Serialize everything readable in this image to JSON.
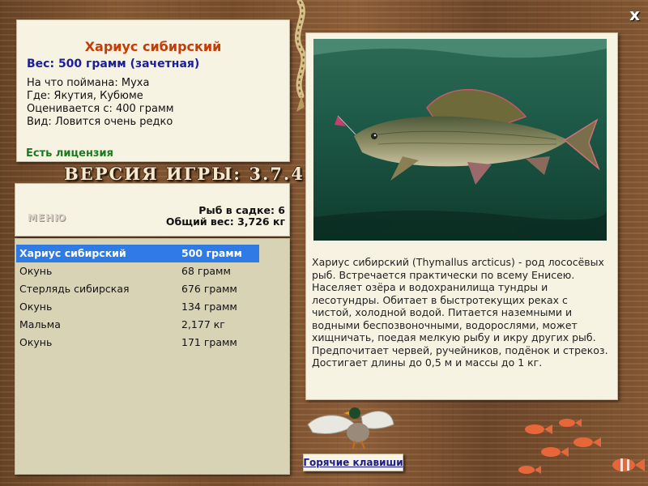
{
  "close_label": "x",
  "fish": {
    "name": "Хариус сибирский",
    "weight": "Вес: 500 грамм (зачетная)",
    "bait": "На что поймана: Муха",
    "location": "Где: Якутия, Кубюме",
    "valued_from": "Оценивается с: 400 грамм",
    "rarity": "Вид: Ловится очень редко",
    "license": "Есть лицензия"
  },
  "version": "ВЕРСИЯ ИГРЫ: 3.7.4",
  "menu_label": "МЕНЮ",
  "stats": {
    "fish_count": "Рыб в садке: 6",
    "total_weight": "Общий вес: 3,726 кг"
  },
  "catch_list": [
    {
      "name": "Хариус сибирский",
      "weight": "500 грамм"
    },
    {
      "name": "Окунь",
      "weight": "68 грамм"
    },
    {
      "name": "Стерлядь сибирская",
      "weight": "676 грамм"
    },
    {
      "name": "Окунь",
      "weight": "134 грамм"
    },
    {
      "name": "Мальма",
      "weight": "2,177 кг"
    },
    {
      "name": "Окунь",
      "weight": "171 грамм"
    }
  ],
  "selected_index": 0,
  "description": "Хариус сибирский (Thymallus arcticus) - род лососёвых рыб. Встречается практически по всему Енисею. Населяет озёра и водохранилища тундры и лесотундры. Обитает в быстротекущих реках с чистой, холодной водой. Питается наземными и водными беспозвоночными, водорослями, может хищничать, поедая мелкую рыбу и икру других рыб. Предпочитает червей, ручейников, подёнок и стрекоз. Достигает длины до 0,5 м и массы до 1 кг.",
  "hotkeys_label": "Горячие клавиши",
  "colors": {
    "fish_name": "#c43c08",
    "weight": "#1a1f96",
    "license": "#1c7a1c",
    "selection": "#2f7be6"
  },
  "icons": [
    "close-icon",
    "lure-icon",
    "duck-icon",
    "goldfish-icon"
  ]
}
